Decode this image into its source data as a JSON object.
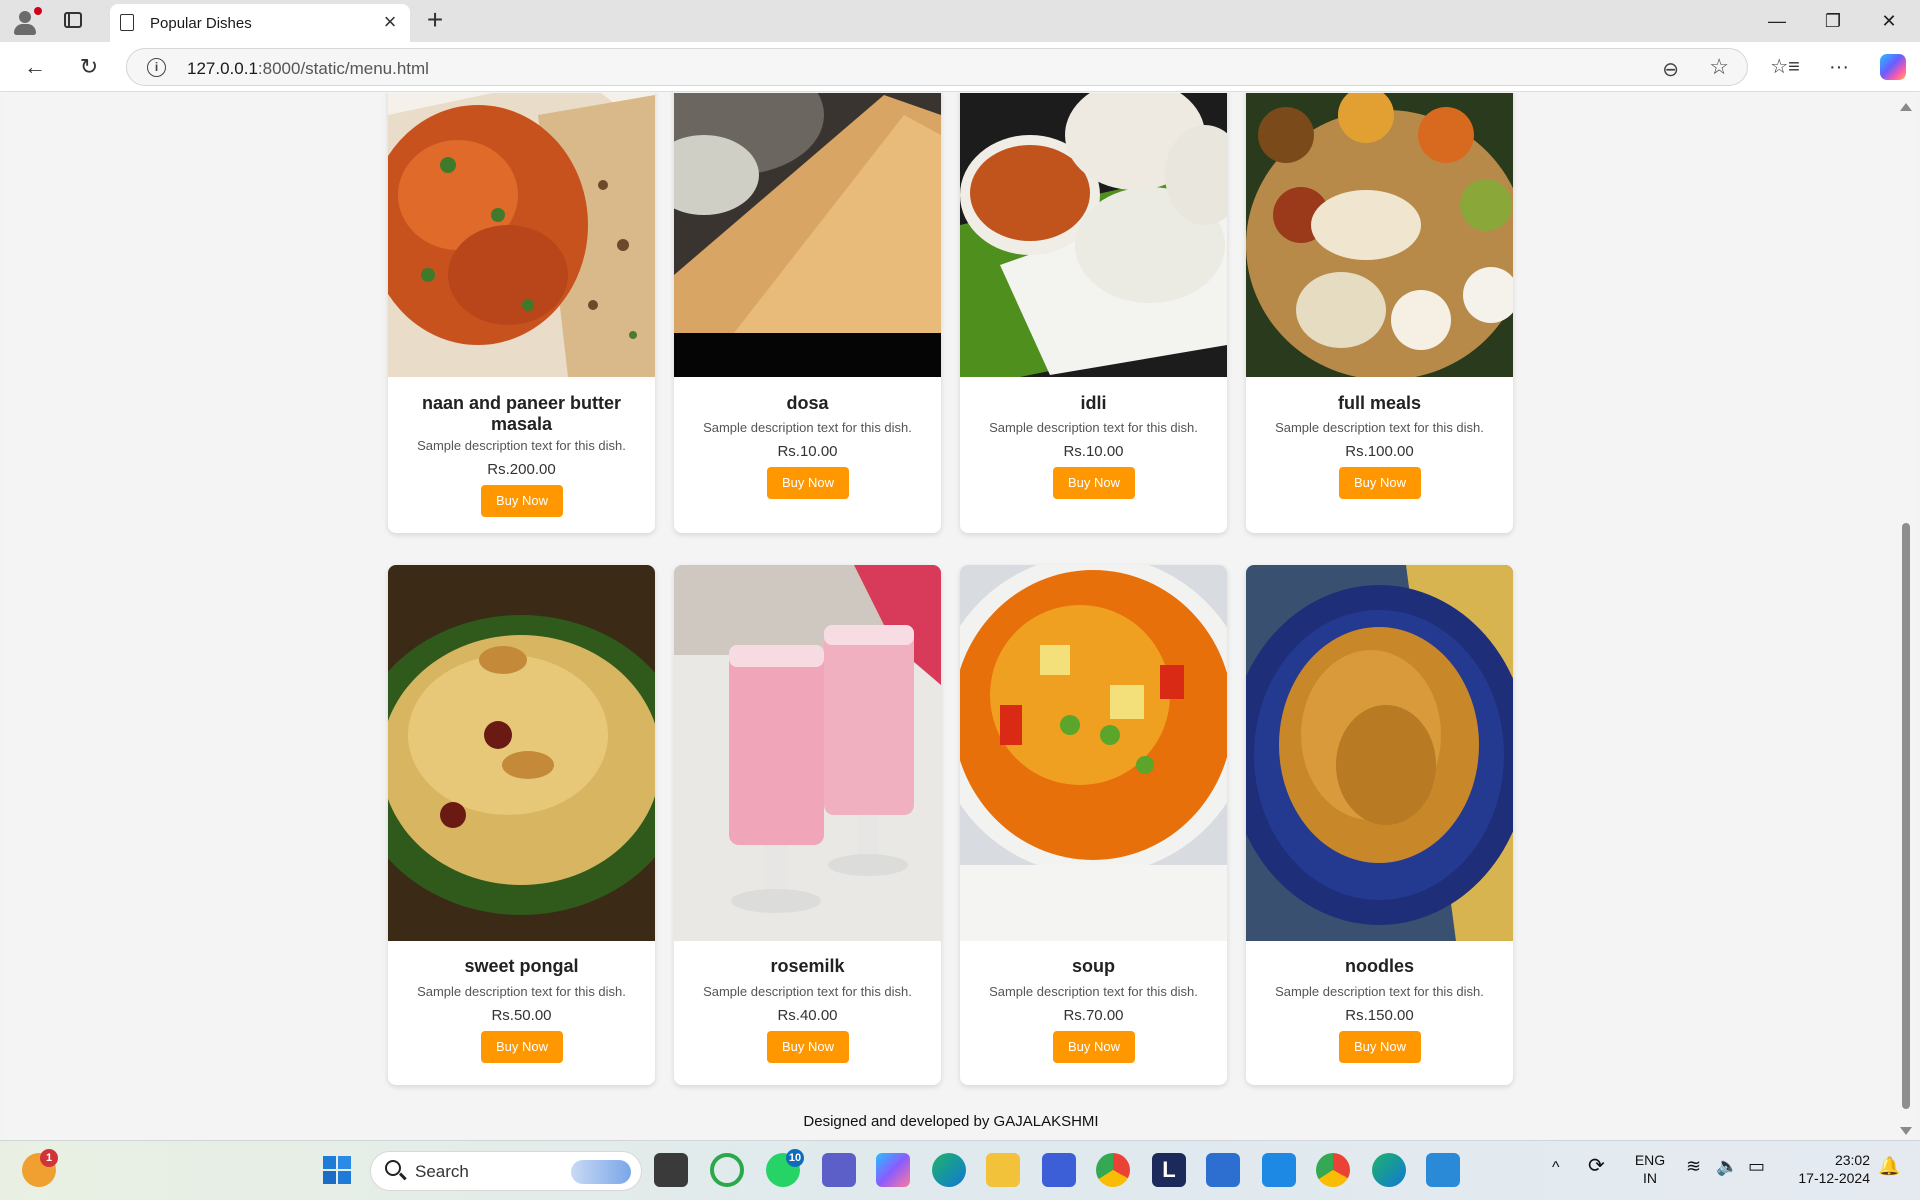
{
  "browser": {
    "tab_title": "Popular Dishes",
    "url_host": "127.0.0.1",
    "url_path": ":8000/static/menu.html"
  },
  "menu": {
    "row1": [
      {
        "name": "naan and paneer butter masala",
        "desc": "Sample description text for this dish.",
        "price": "Rs.200.00",
        "buy": "Buy Now"
      },
      {
        "name": "dosa",
        "desc": "Sample description text for this dish.",
        "price": "Rs.10.00",
        "buy": "Buy Now"
      },
      {
        "name": "idli",
        "desc": "Sample description text for this dish.",
        "price": "Rs.10.00",
        "buy": "Buy Now"
      },
      {
        "name": "full meals",
        "desc": "Sample description text for this dish.",
        "price": "Rs.100.00",
        "buy": "Buy Now"
      }
    ],
    "row2": [
      {
        "name": "sweet pongal",
        "desc": "Sample description text for this dish.",
        "price": "Rs.50.00",
        "buy": "Buy Now"
      },
      {
        "name": "rosemilk",
        "desc": "Sample description text for this dish.",
        "price": "Rs.40.00",
        "buy": "Buy Now"
      },
      {
        "name": "soup",
        "desc": "Sample description text for this dish.",
        "price": "Rs.70.00",
        "buy": "Buy Now"
      },
      {
        "name": "noodles",
        "desc": "Sample description text for this dish.",
        "price": "Rs.150.00",
        "buy": "Buy Now"
      }
    ]
  },
  "footer": "Designed and developed by GAJALAKSHMI",
  "taskbar": {
    "search_label": "Search",
    "notif_count": "1",
    "whatsapp_count": "10",
    "lang_top": "ENG",
    "lang_bottom": "IN",
    "time": "23:02",
    "date": "17-12-2024"
  },
  "colors": {
    "buy_button": "#ff9800",
    "accent": "#0067c0"
  }
}
